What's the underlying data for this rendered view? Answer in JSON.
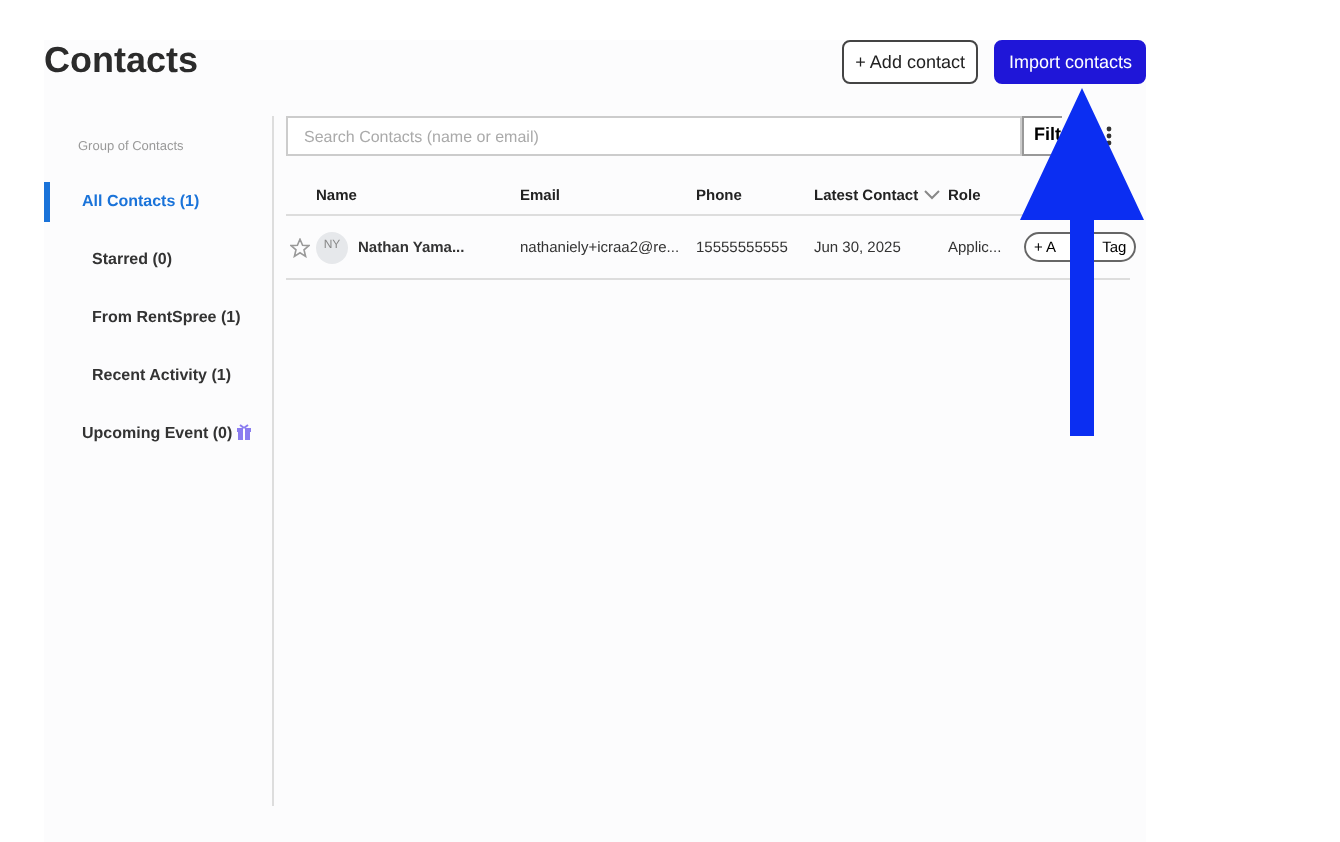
{
  "header": {
    "title": "Contacts",
    "buttons": [
      {
        "label": "+ Add contact",
        "kind": "outline"
      },
      {
        "label": "Import contacts",
        "kind": "primary"
      }
    ]
  },
  "sidebar": {
    "heading": "Group of Contacts",
    "items": [
      {
        "label": "All Contacts (1)",
        "selected": true,
        "children": [
          {
            "label": "Starred (0)",
            "selected": false
          },
          {
            "label": "From RentSpree (1)",
            "selected": false
          },
          {
            "label": "Recent Activity (1)",
            "selected": false
          }
        ]
      },
      {
        "label": "Upcoming Event (0)",
        "selected": false,
        "kind": "gift"
      }
    ]
  },
  "search": {
    "placeholder": "Search Contacts (name or email)"
  },
  "filter_button": {
    "label": "Filt"
  },
  "table": {
    "columns": [
      {
        "label": "Name",
        "sorted": false
      },
      {
        "label": "Email",
        "sorted": false
      },
      {
        "label": "Phone",
        "sorted": false
      },
      {
        "label": "Latest Contact",
        "sorted": true
      },
      {
        "label": "Role",
        "sorted": false
      }
    ],
    "rows": [
      {
        "starred": false,
        "initials": "NY",
        "name": "Nathan Yama...",
        "email": "nathaniely+icraa2@re...",
        "phone": "15555555555",
        "latest_contact": "Jun 30, 2025",
        "role": "Applic...",
        "tag_button": [
          "+ A",
          "Tag"
        ]
      }
    ]
  }
}
